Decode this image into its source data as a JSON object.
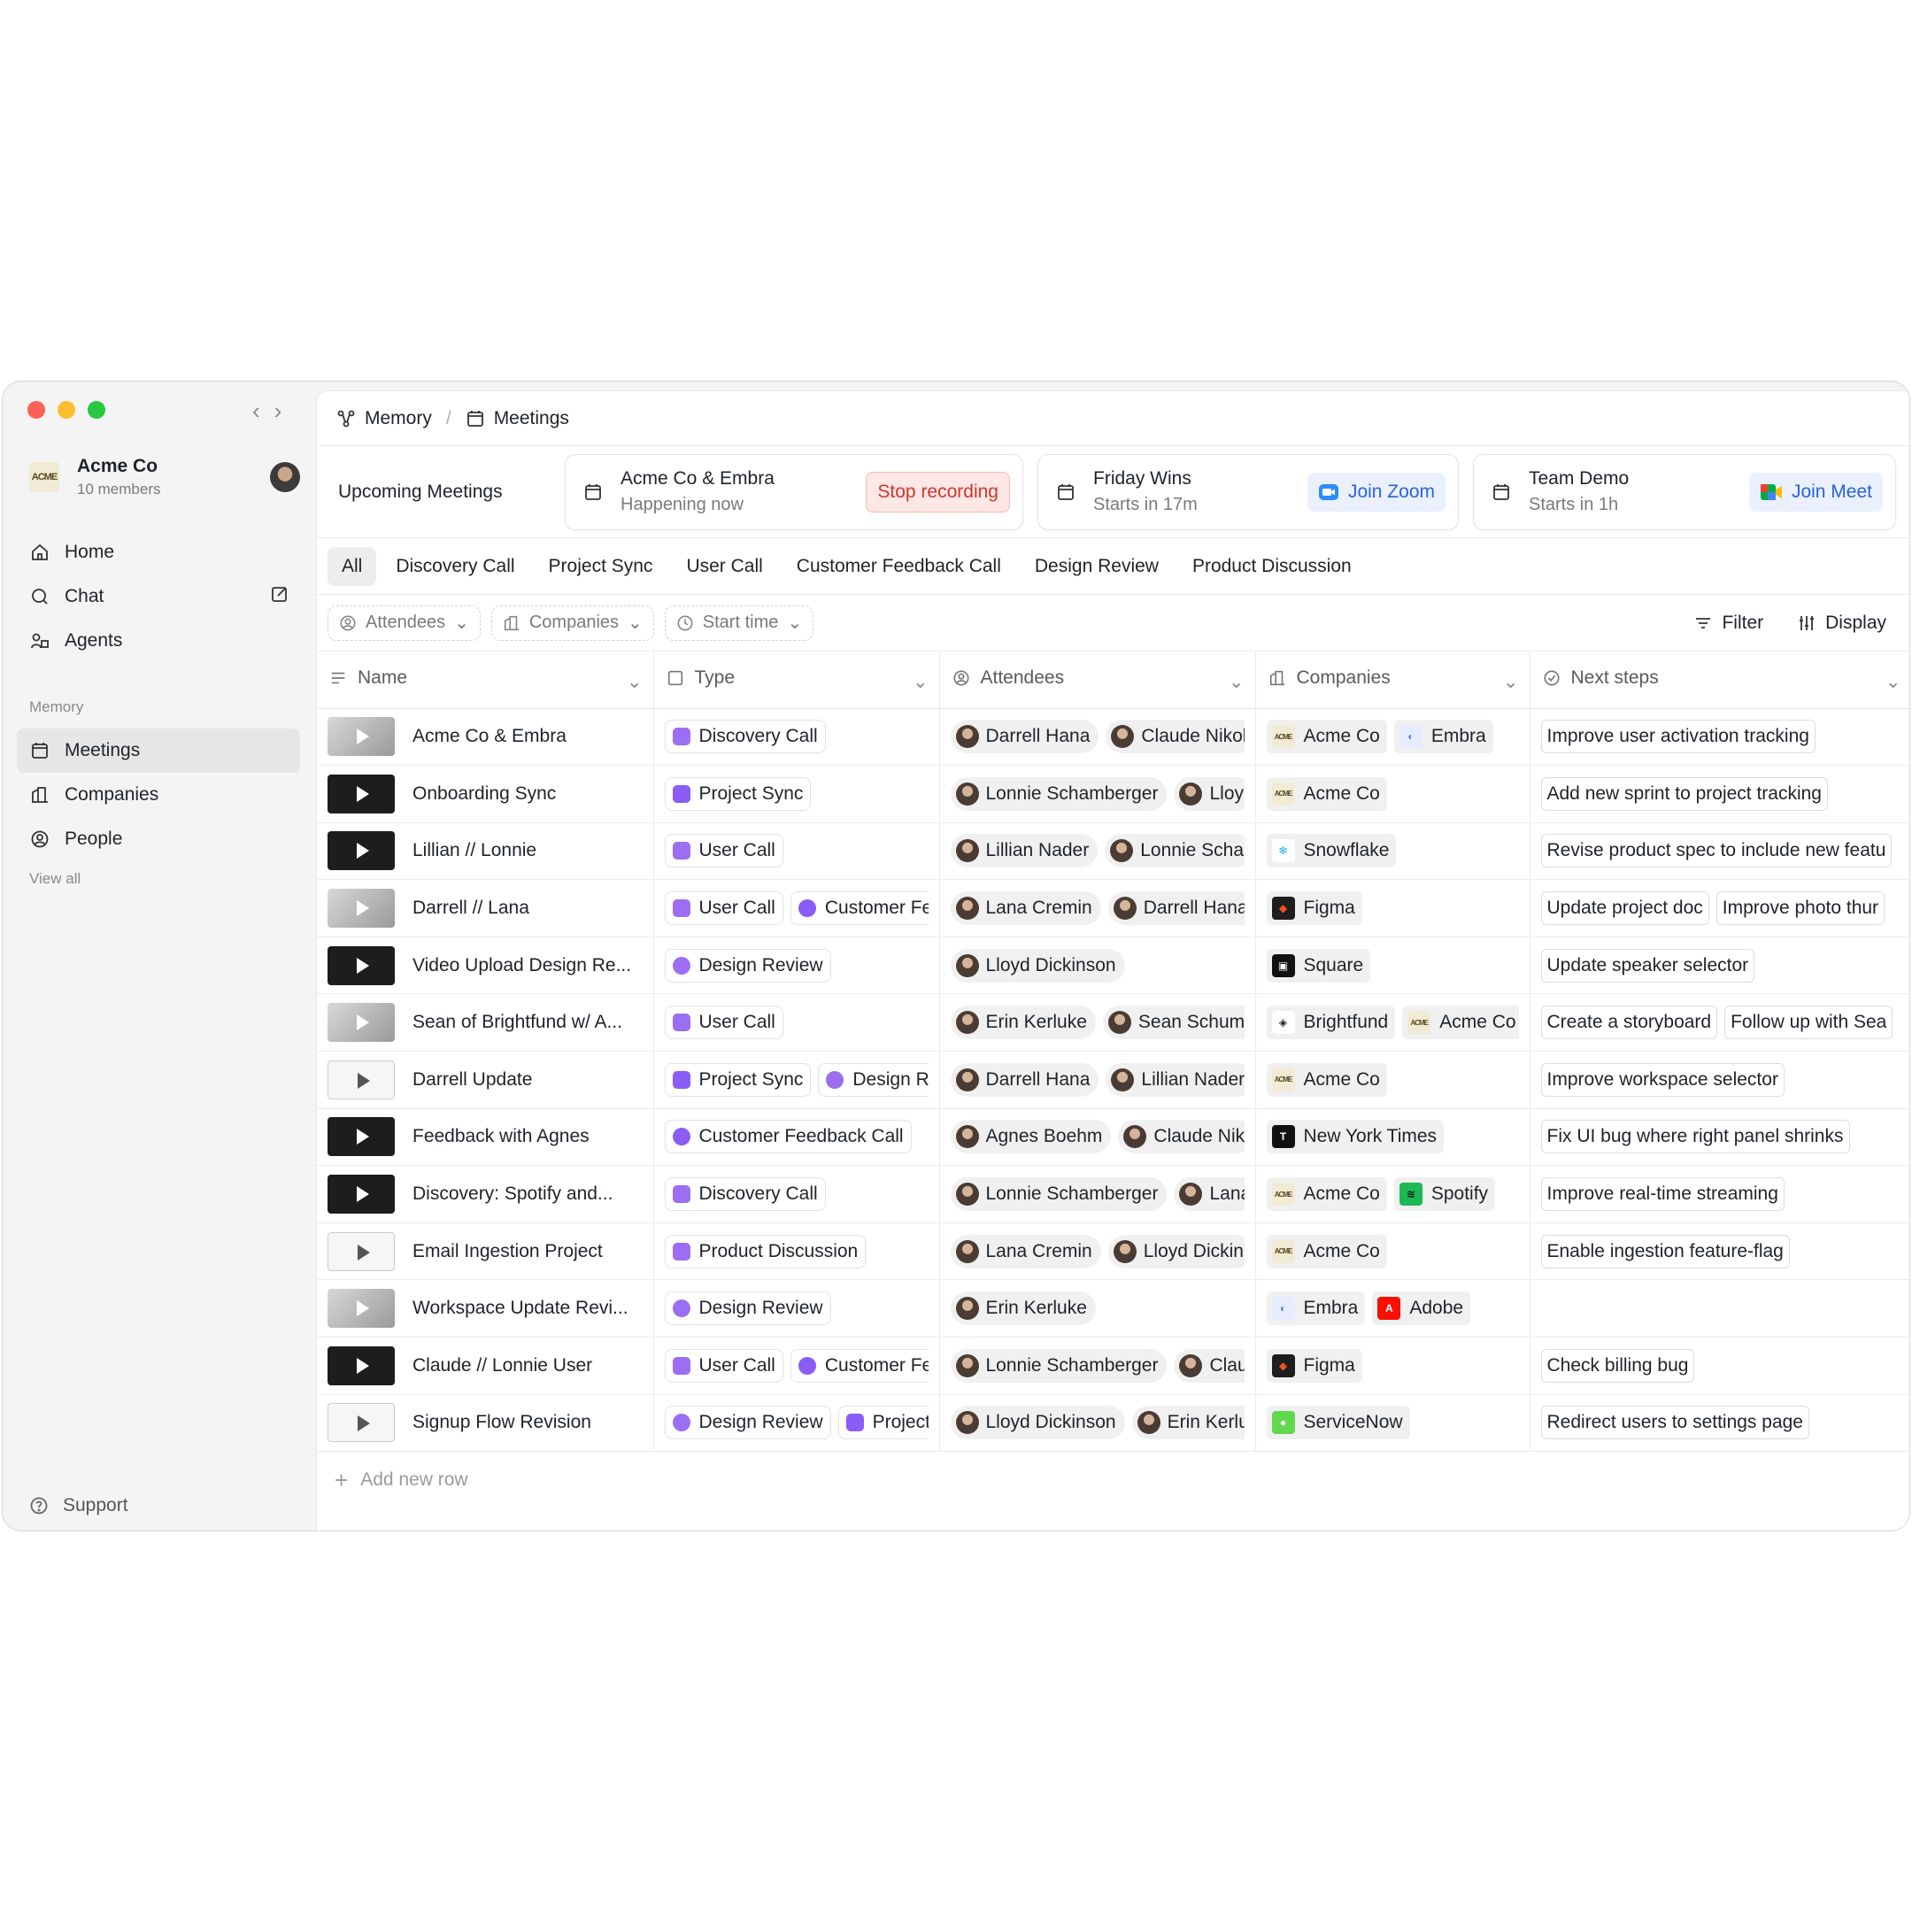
{
  "window": {
    "traffic_colors": [
      "#fe5f57",
      "#febc2e",
      "#28c840"
    ]
  },
  "sidebar": {
    "org_logo": "ACME",
    "org_name": "Acme Co",
    "org_members": "10 members",
    "nav": [
      {
        "label": "Home",
        "icon": "home-icon"
      },
      {
        "label": "Chat",
        "icon": "chat-icon"
      },
      {
        "label": "Agents",
        "icon": "agents-icon"
      }
    ],
    "section_label": "Memory",
    "memory_items": [
      {
        "label": "Meetings",
        "icon": "calendar-icon",
        "active": true
      },
      {
        "label": "Companies",
        "icon": "building-icon"
      },
      {
        "label": "People",
        "icon": "person-icon"
      }
    ],
    "view_all": "View all",
    "support": "Support"
  },
  "breadcrumb": {
    "root": "Memory",
    "current": "Meetings"
  },
  "upcoming": {
    "title": "Upcoming Meetings",
    "cards": [
      {
        "title": "Acme Co & Embra",
        "subtitle": "Happening now",
        "action": "Stop recording"
      },
      {
        "title": "Friday Wins",
        "subtitle": "Starts in 17m",
        "action": "Join Zoom"
      },
      {
        "title": "Team Demo",
        "subtitle": "Starts in 1h",
        "action": "Join Meet"
      }
    ]
  },
  "tabs": [
    "All",
    "Discovery Call",
    "Project Sync",
    "User Call",
    "Customer Feedback Call",
    "Design Review",
    "Product Discussion"
  ],
  "filters": {
    "attendees": "Attendees",
    "companies": "Companies",
    "start_time": "Start time",
    "filter": "Filter",
    "display": "Display"
  },
  "columns": {
    "name": "Name",
    "type": "Type",
    "attendees": "Attendees",
    "companies": "Companies",
    "next_steps": "Next steps"
  },
  "rows": [
    {
      "name": "Acme Co & Embra",
      "types": [
        "Discovery Call"
      ],
      "attendees": [
        "Darrell Hana",
        "Claude Nikol"
      ],
      "companies": [
        "Acme Co",
        "Embra"
      ],
      "next": [
        "Improve user activation tracking"
      ]
    },
    {
      "name": "Onboarding Sync",
      "types": [
        "Project Sync"
      ],
      "attendees": [
        "Lonnie Schamberger",
        "Lloy"
      ],
      "companies": [
        "Acme Co"
      ],
      "next": [
        "Add new sprint to project tracking"
      ]
    },
    {
      "name": "Lillian // Lonnie",
      "types": [
        "User Call"
      ],
      "attendees": [
        "Lillian Nader",
        "Lonnie Scha"
      ],
      "companies": [
        "Snowflake"
      ],
      "next": [
        "Revise product spec to include new featu"
      ]
    },
    {
      "name": "Darrell // Lana",
      "types": [
        "User Call",
        "Customer Fe"
      ],
      "attendees": [
        "Lana Cremin",
        "Darrell Hana"
      ],
      "companies": [
        "Figma"
      ],
      "next": [
        "Update project doc",
        "Improve photo thur"
      ]
    },
    {
      "name": "Video Upload Design Re...",
      "types": [
        "Design Review"
      ],
      "attendees": [
        "Lloyd Dickinson"
      ],
      "companies": [
        "Square"
      ],
      "next": [
        "Update speaker selector"
      ]
    },
    {
      "name": "Sean of Brightfund w/ A...",
      "types": [
        "User Call"
      ],
      "attendees": [
        "Erin Kerluke",
        "Sean Schumi"
      ],
      "companies": [
        "Brightfund",
        "Acme Co"
      ],
      "next": [
        "Create a storyboard",
        "Follow up with Sea"
      ]
    },
    {
      "name": "Darrell Update",
      "types": [
        "Project Sync",
        "Design R"
      ],
      "attendees": [
        "Darrell Hana",
        "Lillian Nader"
      ],
      "companies": [
        "Acme Co"
      ],
      "next": [
        "Improve workspace selector"
      ]
    },
    {
      "name": "Feedback with Agnes",
      "types": [
        "Customer Feedback Call"
      ],
      "attendees": [
        "Agnes Boehm",
        "Claude Nik"
      ],
      "companies": [
        "New York Times"
      ],
      "next": [
        "Fix UI bug where right panel shrinks"
      ]
    },
    {
      "name": "Discovery: Spotify and...",
      "types": [
        "Discovery Call"
      ],
      "attendees": [
        "Lonnie Schamberger",
        "Lana"
      ],
      "companies": [
        "Acme Co",
        "Spotify"
      ],
      "next": [
        "Improve real-time streaming"
      ]
    },
    {
      "name": "Email Ingestion Project",
      "types": [
        "Product Discussion"
      ],
      "attendees": [
        "Lana Cremin",
        "Lloyd Dickin"
      ],
      "companies": [
        "Acme Co"
      ],
      "next": [
        "Enable ingestion feature-flag"
      ]
    },
    {
      "name": "Workspace Update Revi...",
      "types": [
        "Design Review"
      ],
      "attendees": [
        "Erin Kerluke"
      ],
      "companies": [
        "Embra",
        "Adobe"
      ],
      "next": []
    },
    {
      "name": "Claude // Lonnie User",
      "types": [
        "User Call",
        "Customer Fe"
      ],
      "attendees": [
        "Lonnie Schamberger",
        "Clau"
      ],
      "companies": [
        "Figma"
      ],
      "next": [
        "Check billing bug"
      ]
    },
    {
      "name": "Signup Flow Revision",
      "types": [
        "Design Review",
        "Project"
      ],
      "attendees": [
        "Lloyd Dickinson",
        "Erin Kerlu"
      ],
      "companies": [
        "ServiceNow"
      ],
      "next": [
        "Redirect users to settings page"
      ]
    }
  ],
  "add_row": "Add new row"
}
